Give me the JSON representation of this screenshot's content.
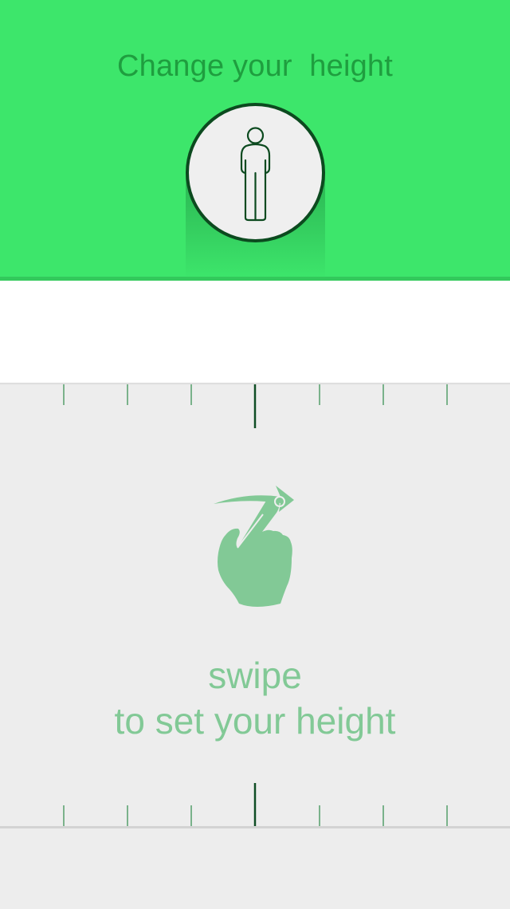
{
  "header": {
    "title": "Change your  height",
    "background_color": "#3de66b",
    "title_color": "#1f9e3f",
    "avatar_icon": "person-outline-icon"
  },
  "value_display": {
    "value": ""
  },
  "ruler": {
    "tick_color": "#1b7a3a",
    "center_tick_color": "#0f4d24"
  },
  "swipe_hint": {
    "icon": "hand-swipe-icon",
    "line1": "swipe",
    "line2": "to set your height",
    "color": "#82c996"
  }
}
